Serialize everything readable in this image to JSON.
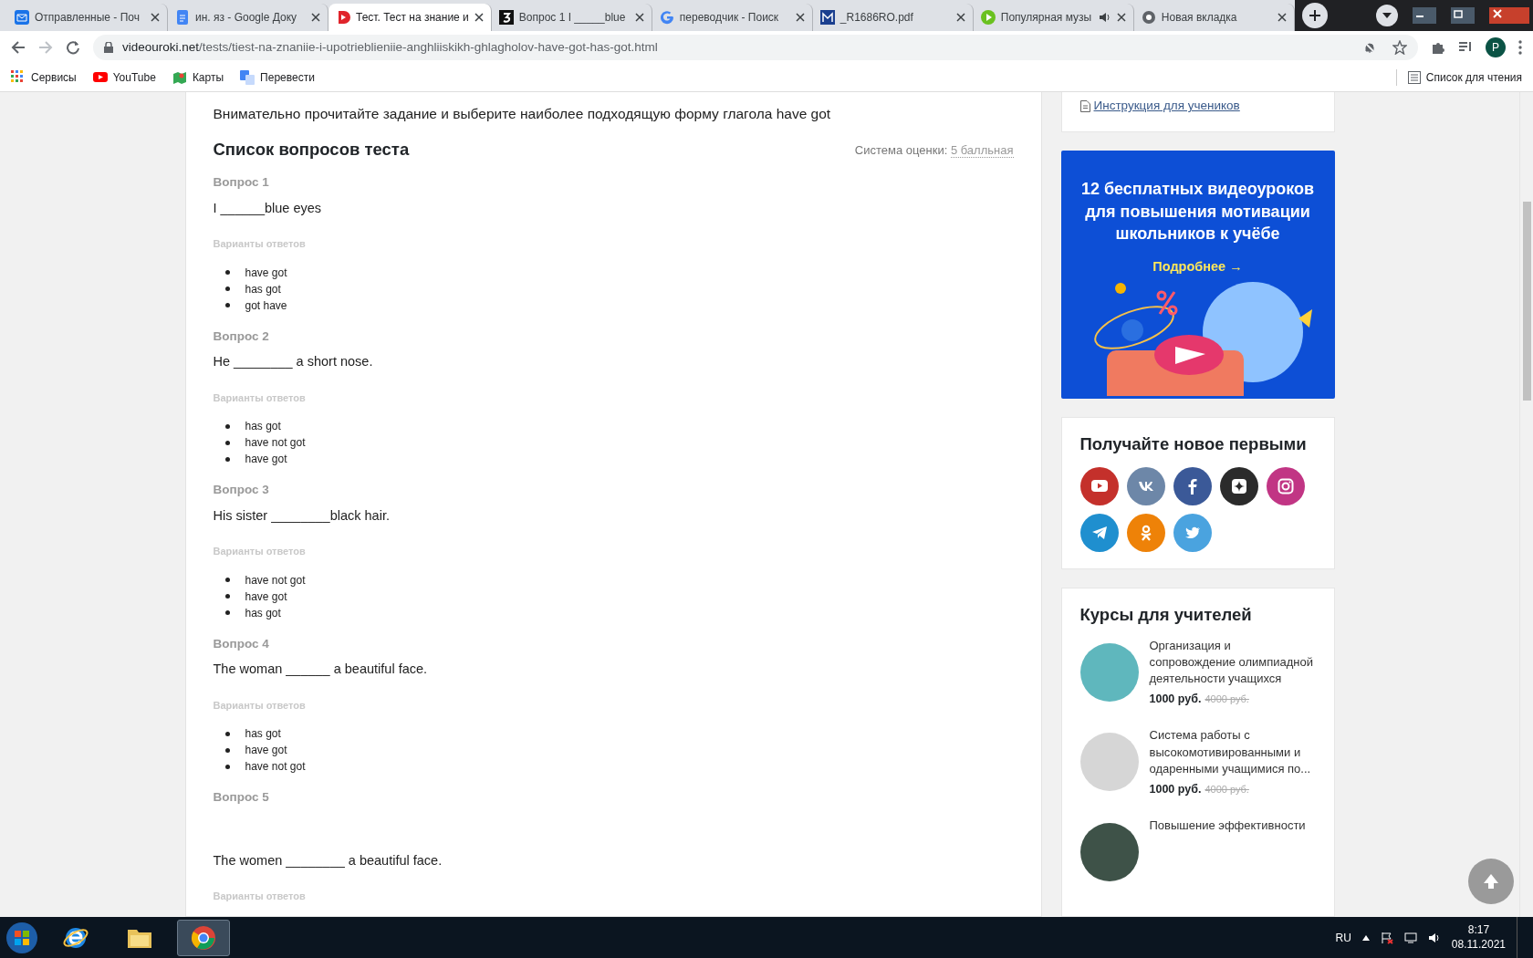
{
  "browser": {
    "tabs": [
      {
        "kind": "mail",
        "title": "Отправленные - Поч",
        "selected": false,
        "audio": false
      },
      {
        "kind": "docs",
        "title": "ин. яз - Google Доку",
        "selected": false,
        "audio": false
      },
      {
        "kind": "video",
        "title": "Тест. Тест на знание и",
        "selected": true,
        "audio": false
      },
      {
        "kind": "quiz",
        "title": "Вопрос 1 I _____blue",
        "selected": false,
        "audio": false
      },
      {
        "kind": "search",
        "title": "переводчик - Поиск",
        "selected": false,
        "audio": false
      },
      {
        "kind": "pdf",
        "title": "_R1686RO.pdf",
        "selected": false,
        "audio": false
      },
      {
        "kind": "music",
        "title": "Популярная музы",
        "selected": false,
        "audio": true
      },
      {
        "kind": "chrome",
        "title": "Новая вкладка",
        "selected": false,
        "audio": false
      }
    ],
    "url_host": "videouroki.net",
    "url_path": "/tests/tiest-na-znaniie-i-upotrieblieniie-anghliiskikh-ghlagholov-have-got-has-got.html",
    "profile_initial": "P",
    "bookmarks": [
      {
        "kind": "apps",
        "label": "Сервисы"
      },
      {
        "kind": "video",
        "label": "YouTube"
      },
      {
        "kind": "maps",
        "label": "Карты"
      },
      {
        "kind": "translate",
        "label": "Перевести"
      }
    ],
    "reading_list": "Список для чтения"
  },
  "main": {
    "intro": "Внимательно прочитайте задание и выберите наиболее подходящую форму глагола have got",
    "heading": "Список вопросов теста",
    "grading_label": "Система оценки:",
    "grading_value": "5 балльная",
    "questions": [
      {
        "label": "Вопрос 1",
        "text": "I ______blue eyes",
        "gap_before_text": false,
        "variants_label": "Варианты ответов",
        "options": [
          "have got",
          "has got",
          "got have"
        ]
      },
      {
        "label": "Вопрос 2",
        "text": "He ________ a short nose.",
        "gap_before_text": false,
        "variants_label": "Варианты ответов",
        "options": [
          "has got",
          "have not got",
          "have got"
        ]
      },
      {
        "label": "Вопрос 3",
        "text": "His sister ________black hair.",
        "gap_before_text": false,
        "variants_label": "Варианты ответов",
        "options": [
          "have not got",
          "have got",
          "has got"
        ]
      },
      {
        "label": "Вопрос 4",
        "text": "The woman ______ a beautiful face.",
        "gap_before_text": false,
        "variants_label": "Варианты ответов",
        "options": [
          "has got",
          "have got",
          "have not got"
        ]
      },
      {
        "label": "Вопрос 5",
        "text": "The women ________ a beautiful face.",
        "gap_before_text": true,
        "variants_label": "Варианты ответов"
      }
    ]
  },
  "sidebar": {
    "instruction_link": "Инструкция для учеников",
    "banner": {
      "headline": "12 **бесплатных** видеоуроков для повышения мотивации школьников к учёбе",
      "more_link": "Подробнее →"
    },
    "social": {
      "title": "Получайте новое первыми",
      "links": [
        {
          "kind": "play",
          "color": "#c4302b"
        },
        {
          "kind": "vk",
          "color": "#6d87a8"
        },
        {
          "kind": "facebook",
          "color": "#3b5998"
        },
        {
          "kind": "zen",
          "color": "#2b2b2b"
        },
        {
          "kind": "camera",
          "color": "#c13584"
        },
        {
          "kind": "plane",
          "color": "#1f8fcf"
        },
        {
          "kind": "ok",
          "color": "#ee8208"
        },
        {
          "kind": "bird",
          "color": "#4aa3df"
        }
      ]
    },
    "courses": {
      "title": "Курсы для учителей",
      "items": [
        {
          "kind": "books",
          "title": "Организация и сопровождение олимпиадной деятельности учащихся",
          "price": "1000 руб.",
          "old_price": "4000 руб."
        },
        {
          "kind": "bulb",
          "title": "Система работы с высокомотивированными и одаренными учащимися по...",
          "price": "1000 руб.",
          "old_price": "4000 руб."
        },
        {
          "kind": "dark",
          "title": "Повышение эффективности"
        }
      ]
    }
  },
  "taskbar": {
    "apps": [
      {
        "kind": "ie",
        "selected": false
      },
      {
        "kind": "folder",
        "selected": false
      },
      {
        "kind": "chrome",
        "selected": true
      }
    ],
    "language": "RU",
    "time": "8:17",
    "date": "08.11.2021"
  }
}
